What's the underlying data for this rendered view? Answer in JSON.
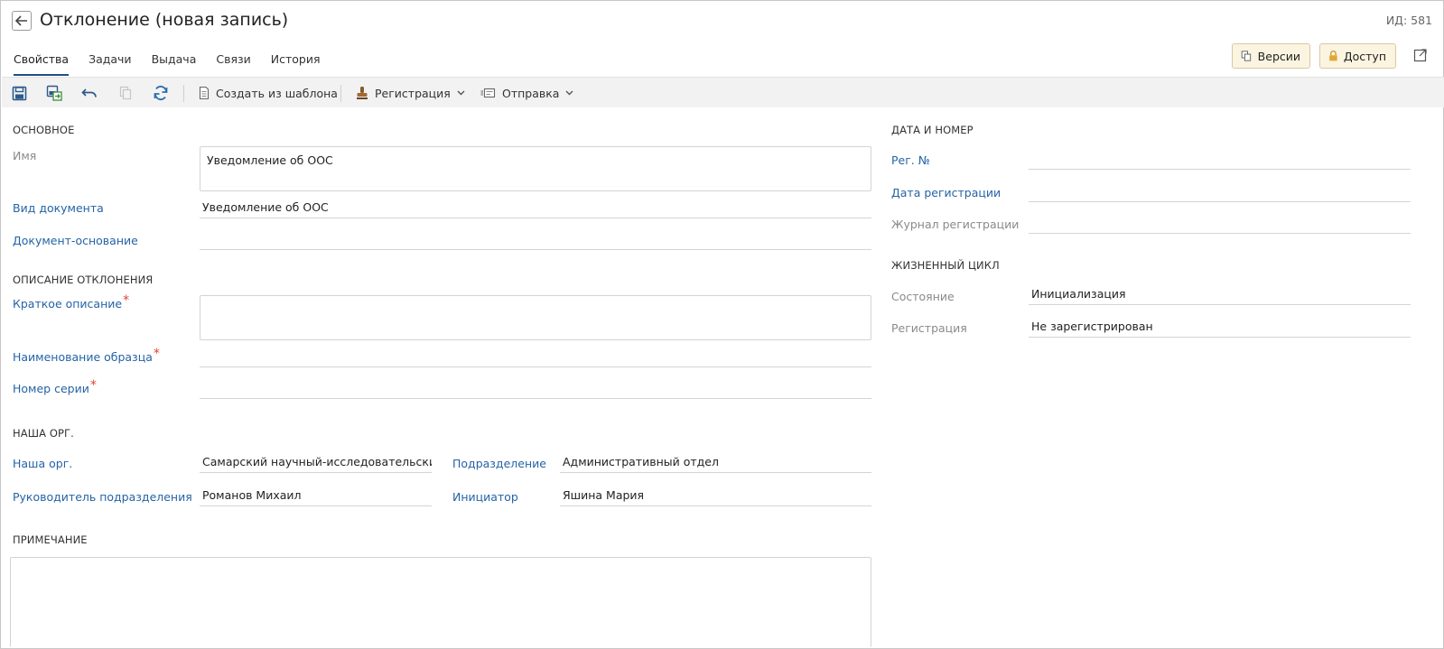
{
  "header": {
    "title": "Отклонение (новая запись)",
    "record_id": "ИД: 581",
    "tabs": [
      {
        "label": "Свойства"
      },
      {
        "label": "Задачи"
      },
      {
        "label": "Выдача"
      },
      {
        "label": "Связи"
      },
      {
        "label": "История"
      }
    ],
    "versions_label": "Версии",
    "access_label": "Доступ"
  },
  "toolbar": {
    "create_from_template_label": "Создать из шаблона",
    "registration_label": "Регистрация",
    "send_label": "Отправка"
  },
  "main": {
    "section_main": "ОСНОВНОЕ",
    "name_label": "Имя",
    "name_value": "Уведомление об ООС",
    "doc_kind_label": "Вид документа",
    "doc_kind_value": "Уведомление об ООС",
    "base_doc_label": "Документ-основание",
    "base_doc_value": "",
    "section_description": "ОПИСАНИЕ ОТКЛОНЕНИЯ",
    "short_desc_label": "Краткое описание",
    "short_desc_value": "",
    "sample_name_label": "Наименование образца",
    "sample_name_value": "",
    "series_label": "Номер серии",
    "series_value": "",
    "required_mark": "*",
    "section_org": "НАША ОРГ.",
    "our_org_label": "Наша орг.",
    "our_org_value": "Самарский научный-исследовательский",
    "department_label": "Подразделение",
    "department_value": "Административный отдел",
    "dept_head_label": "Руководитель подразделения",
    "dept_head_value": "Романов Михаил",
    "initiator_label": "Инициатор",
    "initiator_value": "Яшина Мария",
    "section_note": "ПРИМЕЧАНИЕ",
    "note_value": ""
  },
  "side": {
    "section_date": "ДАТА И НОМЕР",
    "reg_no_label": "Рег. №",
    "reg_no_value": "",
    "reg_date_label": "Дата регистрации",
    "reg_date_value": "",
    "journal_label": "Журнал регистрации",
    "journal_value": "",
    "section_lifecycle": "ЖИЗНЕННЫЙ ЦИКЛ",
    "state_label": "Состояние",
    "state_value": "Инициализация",
    "registration_label": "Регистрация",
    "registration_value": "Не зарегистрирован"
  },
  "colors": {
    "link": "#2563a6",
    "required": "#e0452d",
    "active_tab": "#1f4f85",
    "header_button_bg": "#fbf4e0",
    "toolbar_bg": "#f2f2f2"
  },
  "icons": [
    "back-arrow-icon",
    "versions-icon",
    "lock-icon",
    "popout-icon",
    "save-icon",
    "save-as-icon",
    "undo-icon",
    "copy-icon",
    "refresh-icon",
    "document-icon",
    "stamp-icon",
    "chevron-down-icon",
    "send-icon"
  ]
}
